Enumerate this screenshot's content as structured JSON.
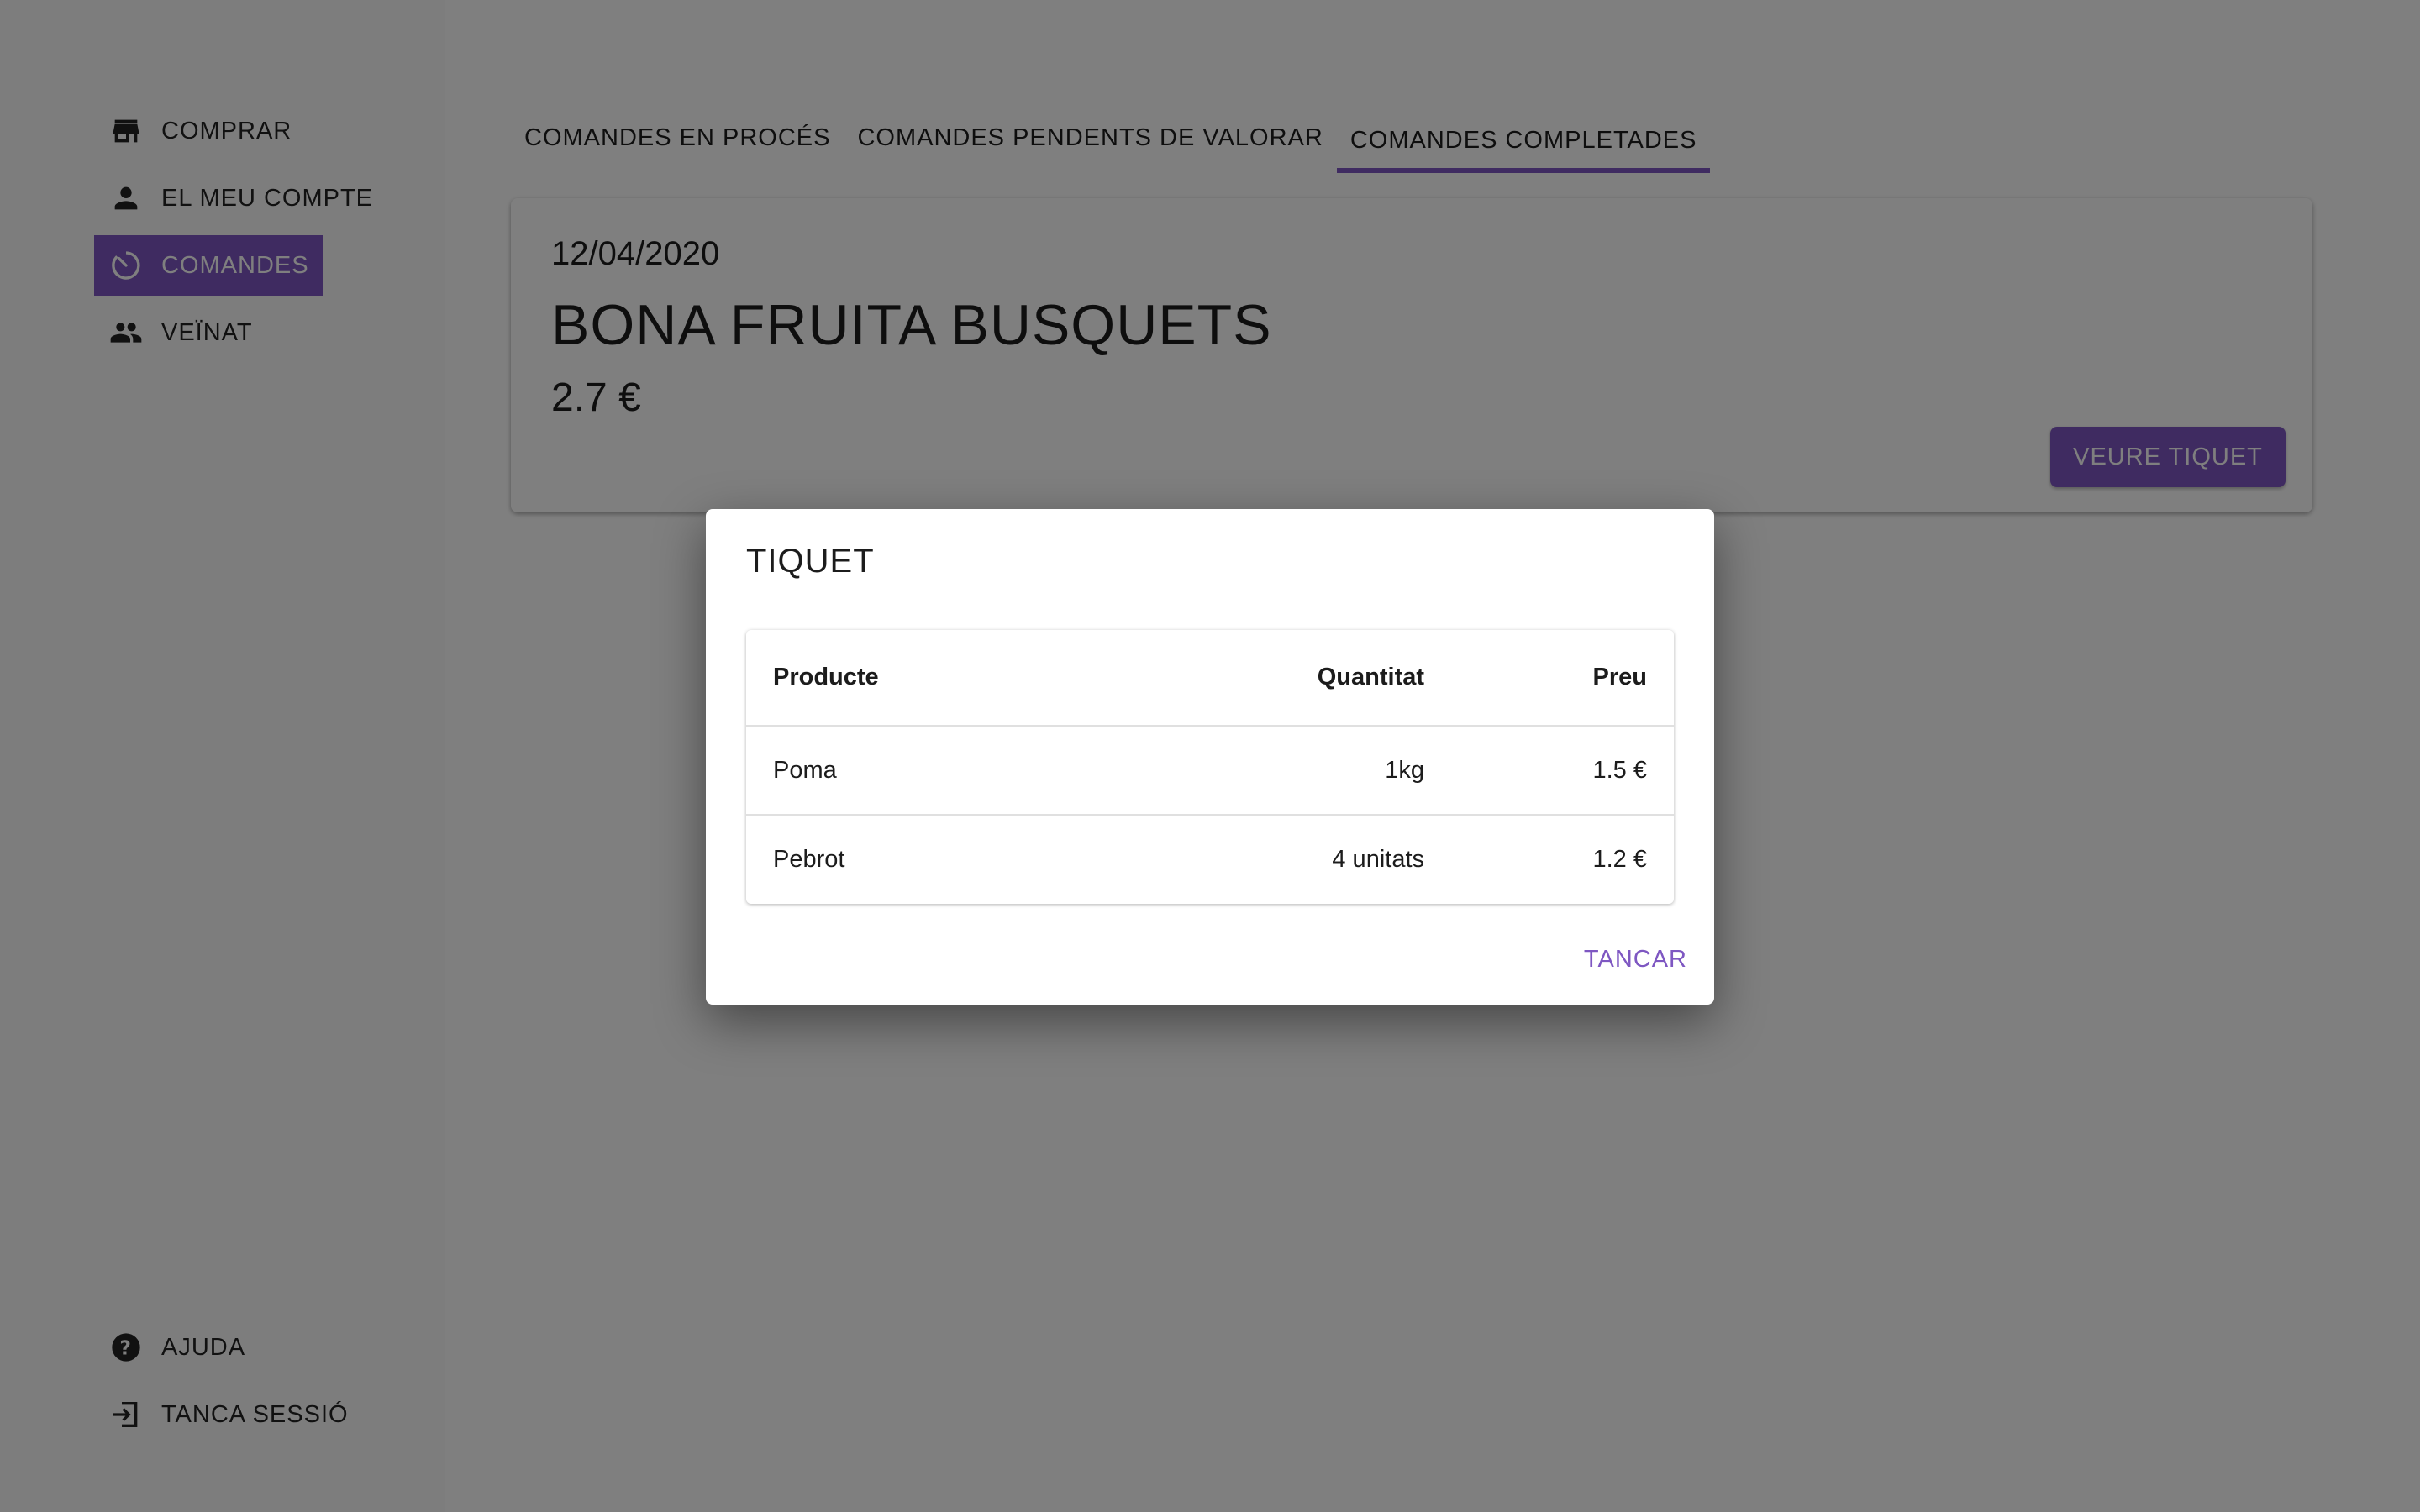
{
  "sidebar": {
    "items": [
      {
        "label": "COMPRAR",
        "icon": "store-icon"
      },
      {
        "label": "EL MEU COMPTE",
        "icon": "person-icon"
      },
      {
        "label": "COMANDES",
        "icon": "orders-timer-icon",
        "active": true
      },
      {
        "label": "VEÏNAT",
        "icon": "people-icon"
      }
    ],
    "bottom_items": [
      {
        "label": "AJUDA",
        "icon": "help-icon"
      },
      {
        "label": "TANCA SESSIÓ",
        "icon": "logout-icon"
      }
    ]
  },
  "tabs": [
    {
      "label": "COMANDES EN PROCÉS"
    },
    {
      "label": "COMANDES PENDENTS DE VALORAR"
    },
    {
      "label": "COMANDES COMPLETADES",
      "active": true
    }
  ],
  "order_card": {
    "date": "12/04/2020",
    "shop": "BONA FRUITA BUSQUETS",
    "price": "2.7 €",
    "button_label": "VEURE TIQUET"
  },
  "dialog": {
    "title": "TIQUET",
    "table": {
      "headers": [
        "Producte",
        "Quantitat",
        "Preu"
      ],
      "rows": [
        [
          "Poma",
          "1kg",
          "1.5 €"
        ],
        [
          "Pebrot",
          "4 unitats",
          "1.2 €"
        ]
      ]
    },
    "close_label": "TANCAR"
  },
  "colors": {
    "accent": "#7e57c2",
    "overlay": "rgba(0,0,0,0.5)"
  }
}
